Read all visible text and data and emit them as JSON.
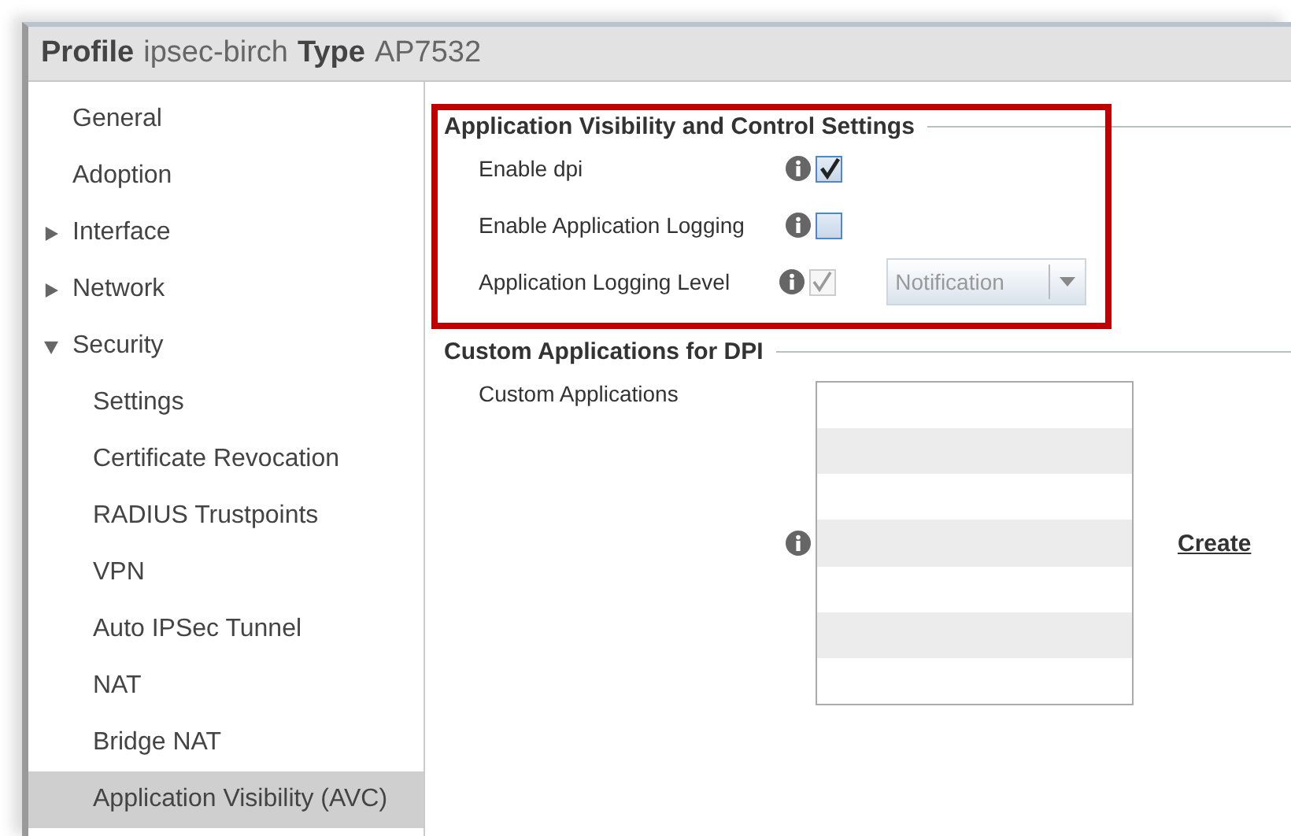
{
  "header": {
    "profile_label": "Profile",
    "profile_value": "ipsec-birch",
    "type_label": "Type",
    "type_value": "AP7532"
  },
  "sidebar": {
    "items": [
      {
        "label": "General",
        "selected": false
      },
      {
        "label": "Adoption",
        "selected": false
      },
      {
        "label": "Interface",
        "selected": false,
        "expanded": false
      },
      {
        "label": "Network",
        "selected": false,
        "expanded": false
      },
      {
        "label": "Security",
        "selected": false,
        "expanded": true,
        "children": [
          {
            "label": "Settings",
            "selected": false
          },
          {
            "label": "Certificate Revocation",
            "selected": false
          },
          {
            "label": "RADIUS Trustpoints",
            "selected": false
          },
          {
            "label": "VPN",
            "selected": false
          },
          {
            "label": "Auto IPSec Tunnel",
            "selected": false
          },
          {
            "label": "NAT",
            "selected": false
          },
          {
            "label": "Bridge NAT",
            "selected": false
          },
          {
            "label": "Application Visibility (AVC)",
            "selected": true
          }
        ]
      }
    ]
  },
  "avc_section": {
    "title": "Application Visibility and Control Settings",
    "highlighted": true,
    "fields": [
      {
        "label": "Enable dpi",
        "checked": true,
        "disabled": false
      },
      {
        "label": "Enable Application Logging",
        "checked": false,
        "disabled": false
      },
      {
        "label": "Application Logging Level",
        "checked": true,
        "disabled": true,
        "select": {
          "value": "Notification",
          "disabled": true
        }
      }
    ]
  },
  "custom_section": {
    "title": "Custom Applications for DPI",
    "label": "Custom Applications",
    "link": "Create"
  }
}
